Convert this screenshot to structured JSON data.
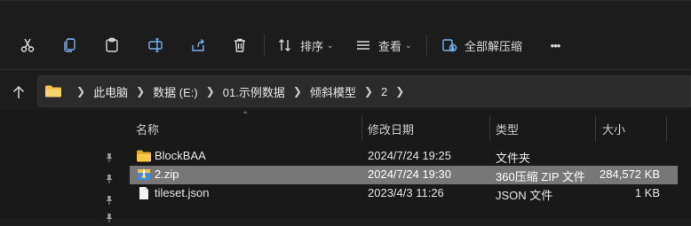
{
  "toolbar": {
    "sort_label": "排序",
    "view_label": "查看",
    "extract_label": "全部解压缩",
    "more_label": "•••"
  },
  "address": {
    "crumbs": [
      "此电脑",
      "数据 (E:)",
      "01.示例数据",
      "倾斜模型",
      "2"
    ]
  },
  "columns": {
    "name": "名称",
    "modified": "修改日期",
    "type": "类型",
    "size": "大小"
  },
  "files": [
    {
      "name": "BlockBAA",
      "modified": "2024/7/24 19:25",
      "type": "文件夹",
      "size": "",
      "icon": "folder-icon"
    },
    {
      "name": "2.zip",
      "modified": "2024/7/24 19:30",
      "type": "360压缩 ZIP 文件",
      "size": "284,572 KB",
      "icon": "zip-archive-icon"
    },
    {
      "name": "tileset.json",
      "modified": "2023/4/3 11:26",
      "type": "JSON 文件",
      "size": "1 KB",
      "icon": "document-icon"
    }
  ],
  "colors": {
    "background": "#1c1c1c",
    "selected_row": "#777777",
    "folder": "#f2c14e",
    "accent": "#7ab4f5"
  }
}
